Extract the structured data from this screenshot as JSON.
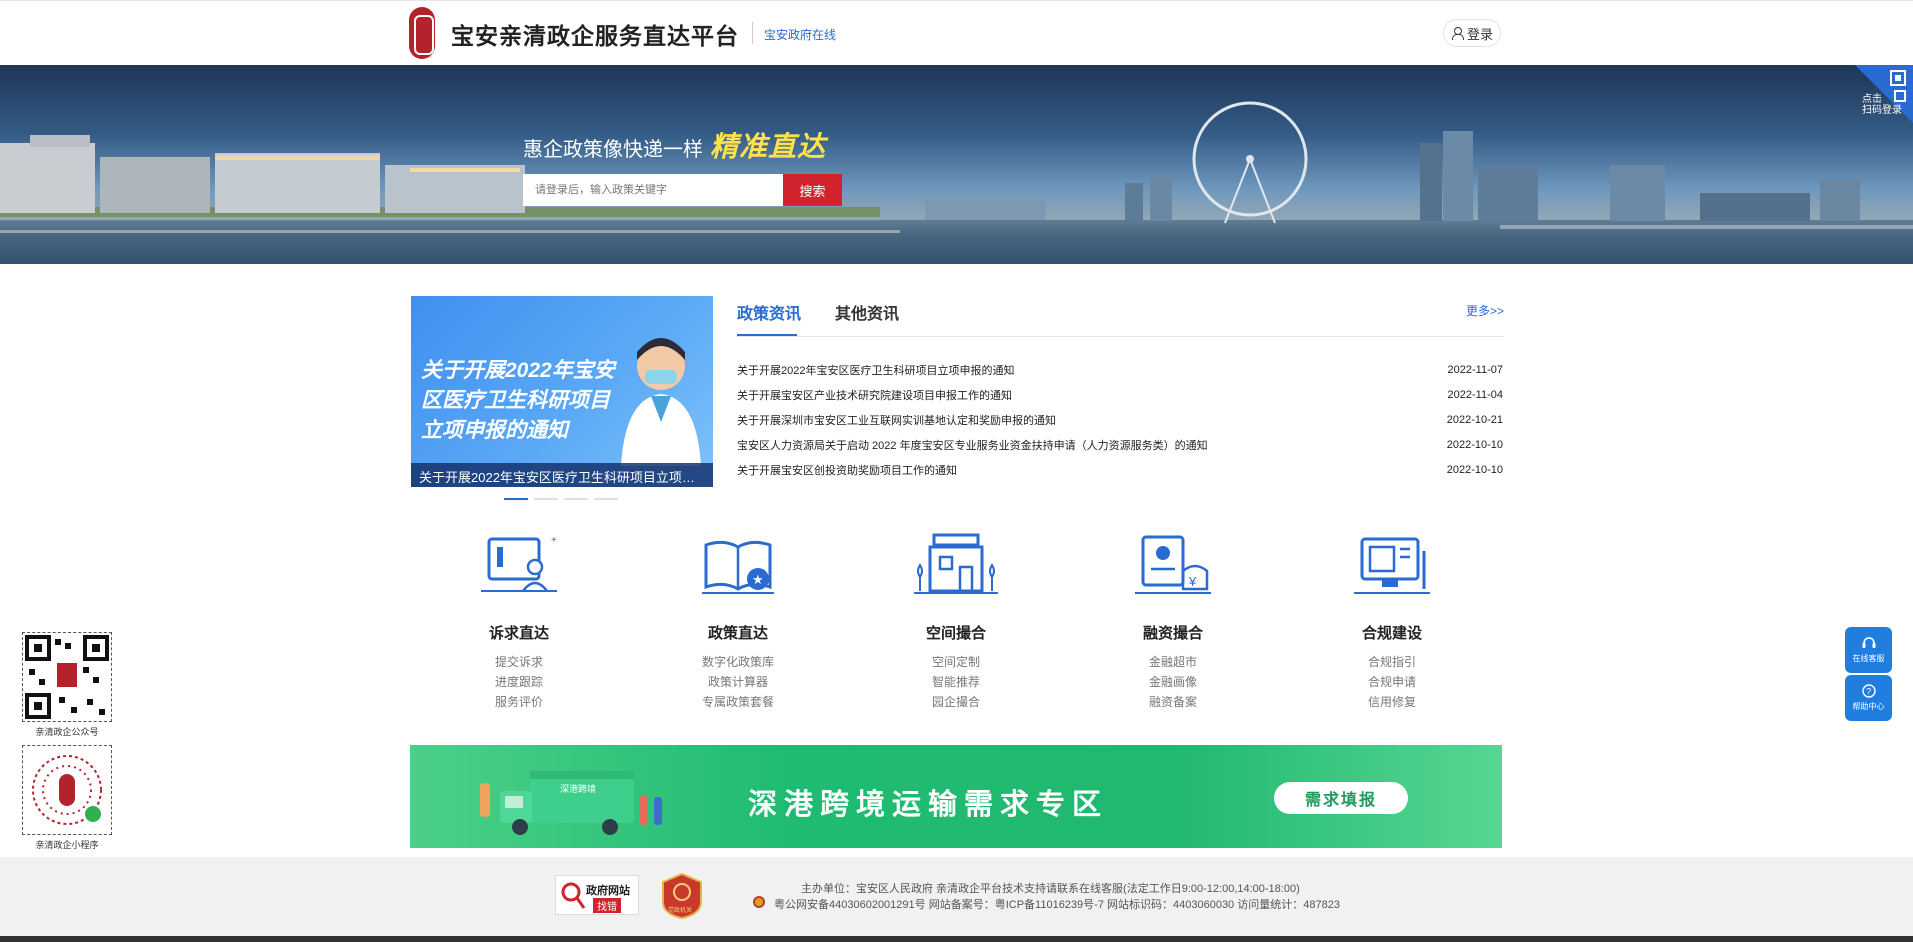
{
  "header": {
    "site_title": "宝安亲清政企服务直达平台",
    "gov_link": "宝安政府在线",
    "login_label": "登录"
  },
  "banner": {
    "slogan": "惠企政策像快递一样",
    "slogan_emphasis": "精准直达",
    "search_placeholder": "请登录后，输入政策关键字",
    "search_button": "搜索",
    "qr_login_line1": "点击",
    "qr_login_line2": "扫码登录"
  },
  "news": {
    "slide_headline_line1": "关于开展2022年宝安",
    "slide_headline_line2": "区医疗卫生科研项目",
    "slide_headline_line3": "立项申报的通知",
    "slide_caption": "关于开展2022年宝安区医疗卫生科研项目立项申报的通知",
    "tabs": [
      {
        "label": "政策资讯",
        "active": true
      },
      {
        "label": "其他资讯",
        "active": false
      }
    ],
    "more_label": "更多>>",
    "items": [
      {
        "title": "关于开展2022年宝安区医疗卫生科研项目立项申报的通知",
        "date": "2022-11-07"
      },
      {
        "title": "关于开展宝安区产业技术研究院建设项目申报工作的通知",
        "date": "2022-11-04"
      },
      {
        "title": "关于开展深圳市宝安区工业互联网实训基地认定和奖励申报的通知",
        "date": "2022-10-21"
      },
      {
        "title": "宝安区人力资源局关于启动 2022 年度宝安区专业服务业资金扶持申请（人力资源服务类）的通知",
        "date": "2022-10-10"
      },
      {
        "title": "关于开展宝安区创投资助奖励项目工作的通知",
        "date": "2022-10-10"
      }
    ]
  },
  "services": [
    {
      "title": "诉求直达",
      "icon": "petition-icon",
      "links": [
        "提交诉求",
        "进度跟踪",
        "服务评价"
      ]
    },
    {
      "title": "政策直达",
      "icon": "policy-book-icon",
      "links": [
        "数字化政策库",
        "政策计算器",
        "专属政策套餐"
      ]
    },
    {
      "title": "空间撮合",
      "icon": "building-icon",
      "links": [
        "空间定制",
        "智能推荐",
        "园企撮合"
      ]
    },
    {
      "title": "融资撮合",
      "icon": "finance-icon",
      "links": [
        "金融超市",
        "金融画像",
        "融资备案"
      ]
    },
    {
      "title": "合规建设",
      "icon": "compliance-icon",
      "links": [
        "合规指引",
        "合规申请",
        "信用修复"
      ]
    }
  ],
  "transport": {
    "title": "深港跨境运输需求专区",
    "button": "需求填报",
    "truck_sign": "深港跨境"
  },
  "side": {
    "wechat_label": "亲清政企公众号",
    "miniapp_label": "亲清政企小程序",
    "online_service": "在线客服",
    "help_center": "帮助中心"
  },
  "footer": {
    "gov_badge_top": "政府网站",
    "gov_badge_bottom": "找错",
    "party_badge": "党政机关",
    "line1": "主办单位：宝安区人民政府  亲清政企平台技术支持请联系在线客服(法定工作日9:00-12:00,14:00-18:00)",
    "line2": "粤公网安备44030602001291号  网站备案号：粤ICP备11016239号-7  网站标识码：4403060030  访问量统计：487823"
  }
}
